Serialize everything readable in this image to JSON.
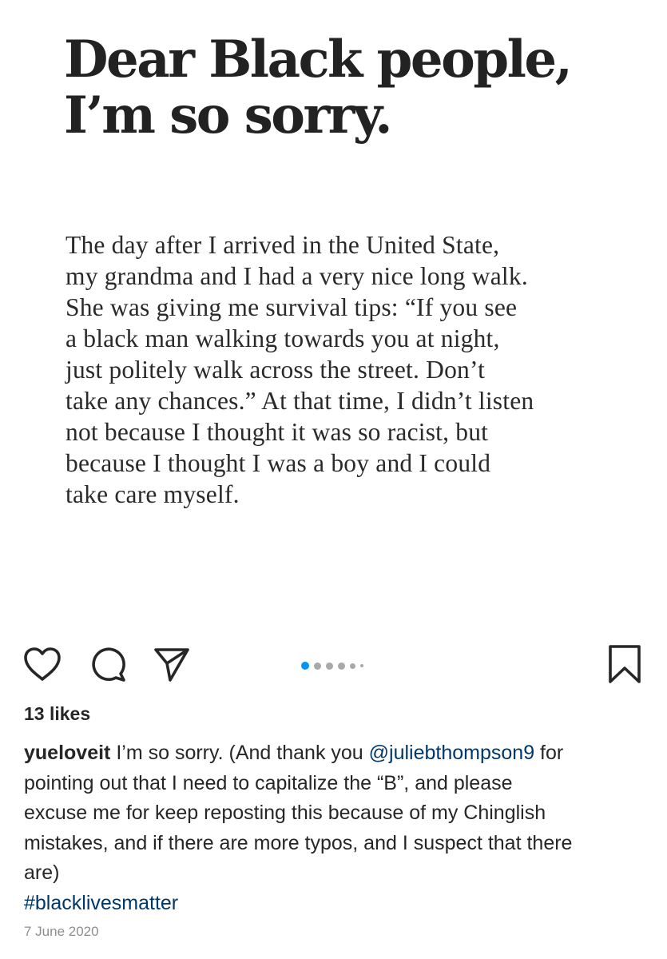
{
  "post_image": {
    "headline_lines": [
      "Dear Black people,",
      "I’m so sorry."
    ],
    "body_lines": [
      "The day after I arrived in the United State,",
      "my grandma and I had a very nice long walk.",
      "She was giving me survival tips: “If you see",
      "a black man walking towards you at night,",
      "just politely walk across the street. Don’t",
      "take any chances.” At that time, I didn’t listen",
      "not because I thought it was so racist, but",
      "because I thought I was a boy and I could",
      "take care myself."
    ]
  },
  "actions": {
    "icons": [
      "heart-icon",
      "comment-icon",
      "share-icon",
      "bookmark-icon"
    ],
    "carousel": {
      "total": 6,
      "active_index": 0,
      "active_color": "#0095f6",
      "inactive_color": "#a8a8a8"
    }
  },
  "likes_text": "13 likes",
  "caption": {
    "username": "yueloveit",
    "text_1": " I’m so sorry. (And thank you ",
    "mention": "@juliebthompson9",
    "text_2": " for",
    "line_2": "pointing out that I need to capitalize the “B”, and please",
    "line_3": "excuse me for keep reposting this because of my Chinglish",
    "line_4": "mistakes, and if there are more typos, and I suspect that there",
    "line_5": "are)",
    "hashtag": "#blacklivesmatter"
  },
  "date": "7 June 2020",
  "colors": {
    "link": "#00376b",
    "secondary_text": "#8e8e8e",
    "primary_text": "#262626"
  }
}
